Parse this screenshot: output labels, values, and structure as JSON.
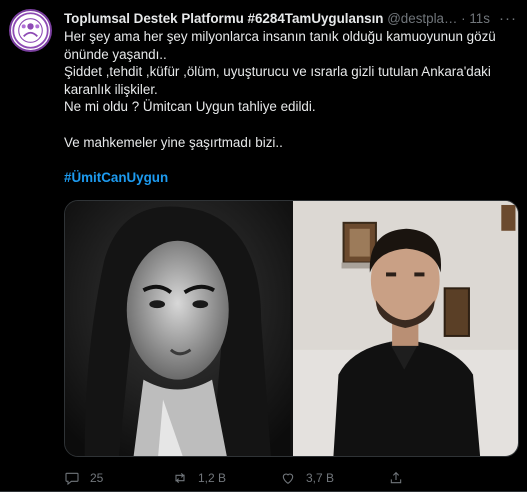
{
  "tweet": {
    "display_name": "Toplumsal Destek Platformu #6284TamUygulansın",
    "handle": "@destpla…",
    "separator": "·",
    "time": "11s",
    "more": "···",
    "lines": [
      "Her şey ama her şey milyonlarca insanın tanık olduğu kamuoyunun gözü önünde yaşandı..",
      "Şiddet ,tehdit ,küfür ,ölüm, uyuşturucu ve ısrarla gizli tutulan Ankara'daki karanlık ilişkiler.",
      "Ne mi oldu ? Ümitcan Uygun tahliye edildi.",
      "Ve mahkemeler yine şaşırtmadı bizi.."
    ],
    "hashtag": "#ÜmitCanUygun"
  },
  "actions": {
    "reply_count": "25",
    "retweet_count": "1,2 B",
    "like_count": "3,7 B"
  },
  "colors": {
    "background": "#000000",
    "text": "#e7e9ea",
    "muted": "#71767b",
    "link": "#1d9bf0",
    "avatar_ring": "#7b3fa0"
  }
}
